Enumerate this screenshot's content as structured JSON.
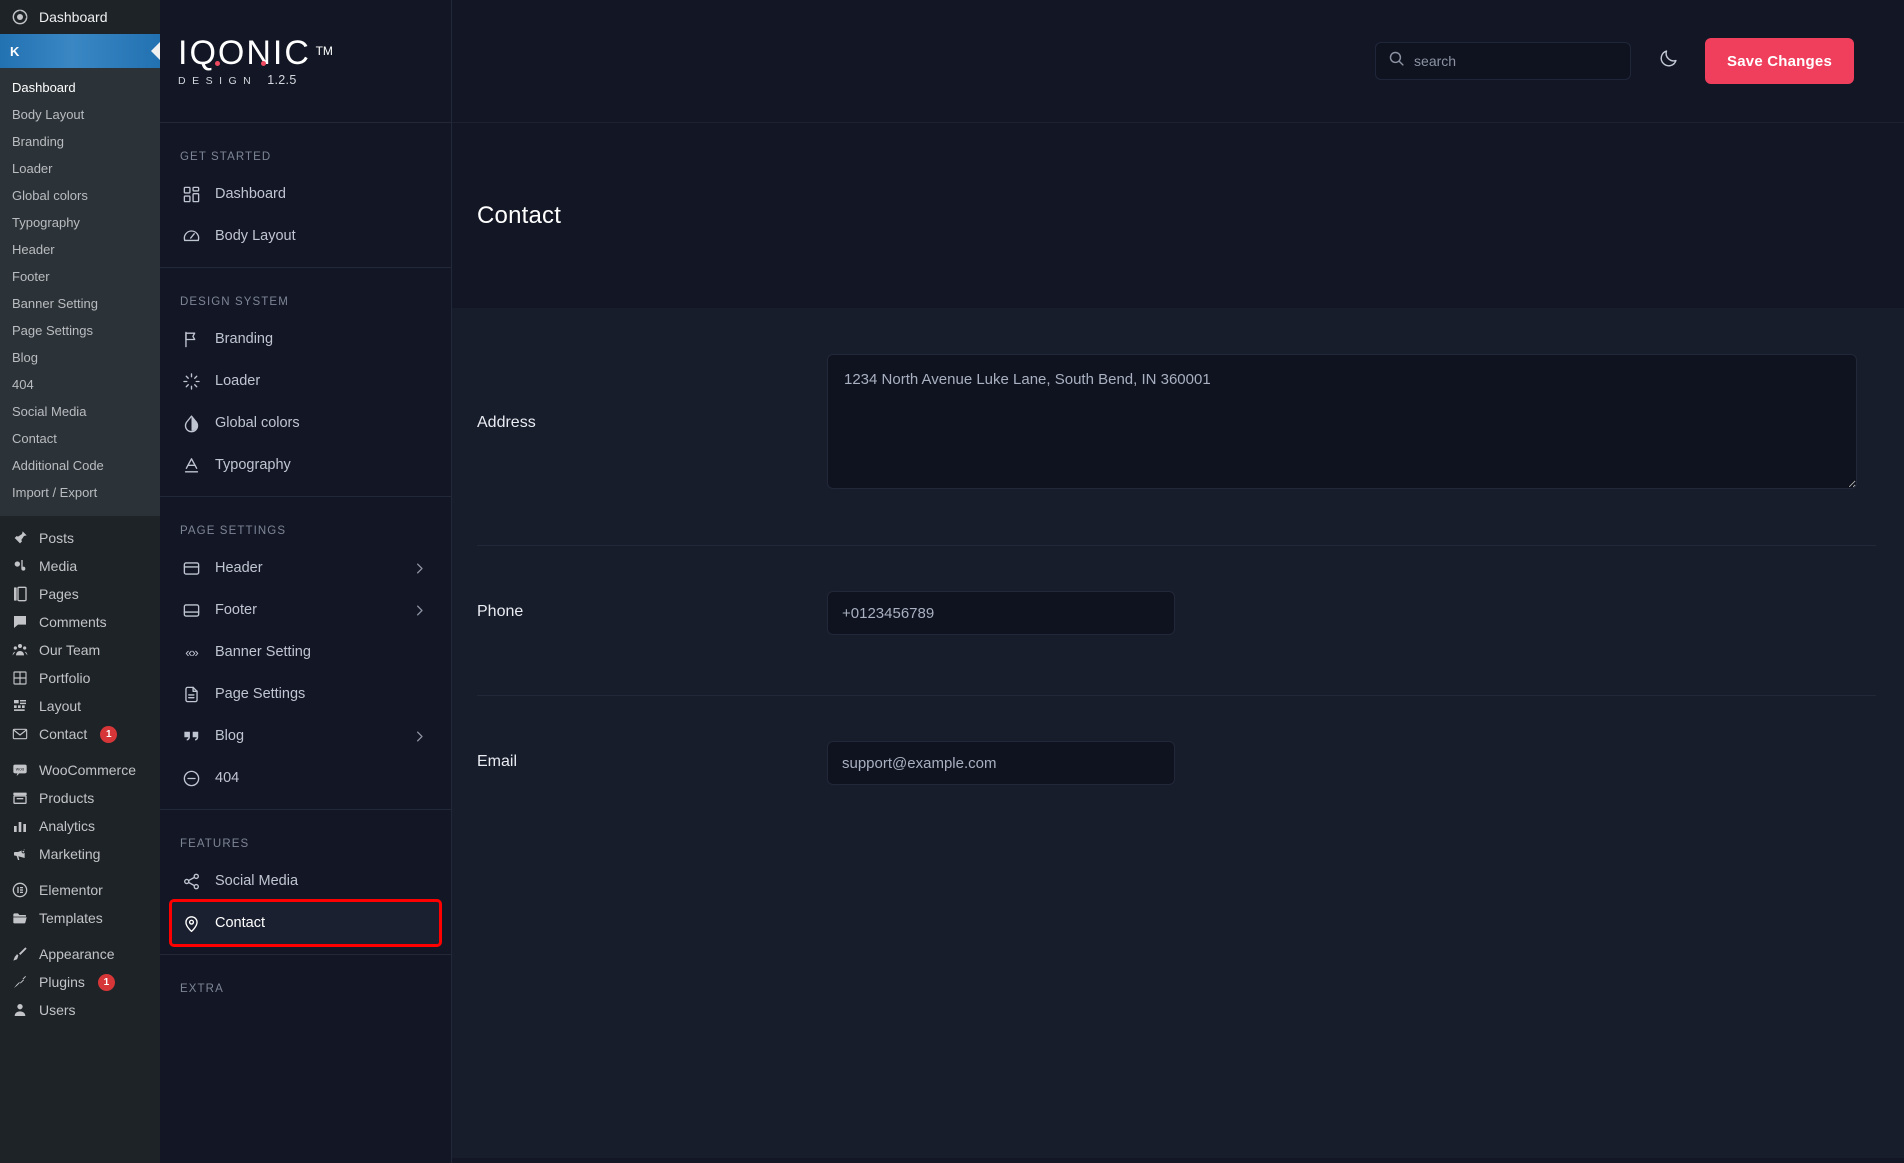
{
  "wp_admin": {
    "top_item": {
      "label": "Dashboard",
      "icon": "dashboard-gauge-icon"
    },
    "active_item": {
      "label": "K",
      "icon": "kit-logo-icon"
    },
    "submenu": [
      {
        "label": "Dashboard",
        "current": true
      },
      {
        "label": "Body Layout",
        "current": false
      },
      {
        "label": "Branding",
        "current": false
      },
      {
        "label": "Loader",
        "current": false
      },
      {
        "label": "Global colors",
        "current": false
      },
      {
        "label": "Typography",
        "current": false
      },
      {
        "label": "Header",
        "current": false
      },
      {
        "label": "Footer",
        "current": false
      },
      {
        "label": "Banner Setting",
        "current": false
      },
      {
        "label": "Page Settings",
        "current": false
      },
      {
        "label": "Blog",
        "current": false
      },
      {
        "label": "404",
        "current": false
      },
      {
        "label": "Social Media",
        "current": false
      },
      {
        "label": "Contact",
        "current": false
      },
      {
        "label": "Additional Code",
        "current": false
      },
      {
        "label": "Import / Export",
        "current": false
      }
    ],
    "groups": [
      {
        "items": [
          {
            "label": "Posts",
            "icon": "pin-icon",
            "badge": ""
          },
          {
            "label": "Media",
            "icon": "media-icon",
            "badge": ""
          },
          {
            "label": "Pages",
            "icon": "pages-icon",
            "badge": ""
          },
          {
            "label": "Comments",
            "icon": "comment-icon",
            "badge": ""
          },
          {
            "label": "Our Team",
            "icon": "team-icon",
            "badge": ""
          },
          {
            "label": "Portfolio",
            "icon": "grid-icon",
            "badge": ""
          },
          {
            "label": "Layout",
            "icon": "layout-icon",
            "badge": ""
          },
          {
            "label": "Contact",
            "icon": "envelope-icon",
            "badge": "1"
          }
        ]
      },
      {
        "items": [
          {
            "label": "WooCommerce",
            "icon": "woocommerce-icon",
            "badge": ""
          },
          {
            "label": "Products",
            "icon": "products-icon",
            "badge": ""
          },
          {
            "label": "Analytics",
            "icon": "analytics-bars-icon",
            "badge": ""
          },
          {
            "label": "Marketing",
            "icon": "megaphone-icon",
            "badge": ""
          }
        ]
      },
      {
        "items": [
          {
            "label": "Elementor",
            "icon": "elementor-icon",
            "badge": ""
          },
          {
            "label": "Templates",
            "icon": "folder-icon",
            "badge": ""
          }
        ]
      },
      {
        "items": [
          {
            "label": "Appearance",
            "icon": "brush-icon",
            "badge": ""
          },
          {
            "label": "Plugins",
            "icon": "plug-icon",
            "badge": "1"
          },
          {
            "label": "Users",
            "icon": "user-icon",
            "badge": ""
          }
        ]
      }
    ]
  },
  "brand": {
    "name": "IQONIC",
    "trademark": "TM",
    "tagline": "DESIGN",
    "version": "1.2.5"
  },
  "panel_nav": {
    "sections": [
      {
        "title": "GET STARTED",
        "items": [
          {
            "label": "Dashboard",
            "icon": "dashboard-grid-icon",
            "chevron": false,
            "highlight": false
          },
          {
            "label": "Body Layout",
            "icon": "speedometer-icon",
            "chevron": false,
            "highlight": false
          }
        ]
      },
      {
        "title": "DESIGN SYSTEM",
        "items": [
          {
            "label": "Branding",
            "icon": "flag-icon",
            "chevron": false,
            "highlight": false
          },
          {
            "label": "Loader",
            "icon": "spinner-icon",
            "chevron": false,
            "highlight": false
          },
          {
            "label": "Global colors",
            "icon": "droplet-icon",
            "chevron": false,
            "highlight": false
          },
          {
            "label": "Typography",
            "icon": "typography-a-icon",
            "chevron": false,
            "highlight": false
          }
        ]
      },
      {
        "title": "PAGE SETTINGS",
        "items": [
          {
            "label": "Header",
            "icon": "header-box-icon",
            "chevron": true,
            "highlight": false
          },
          {
            "label": "Footer",
            "icon": "footer-box-icon",
            "chevron": true,
            "highlight": false
          },
          {
            "label": "Banner Setting",
            "icon": "chevrons-icon",
            "chevron": false,
            "highlight": false
          },
          {
            "label": "Page Settings",
            "icon": "document-icon",
            "chevron": false,
            "highlight": false
          },
          {
            "label": "Blog",
            "icon": "quote-icon",
            "chevron": true,
            "highlight": false
          },
          {
            "label": "404",
            "icon": "minus-circle-icon",
            "chevron": false,
            "highlight": false
          }
        ]
      },
      {
        "title": "FEATURES",
        "items": [
          {
            "label": "Social Media",
            "icon": "share-icon",
            "chevron": false,
            "highlight": false
          },
          {
            "label": "Contact",
            "icon": "map-pin-icon",
            "chevron": false,
            "highlight": true
          }
        ]
      },
      {
        "title": "EXTRA",
        "items": []
      }
    ]
  },
  "topbar": {
    "search_placeholder": "search",
    "search_value": "",
    "dark_mode_icon": "moon-icon",
    "save_label": "Save Changes"
  },
  "page": {
    "title": "Contact"
  },
  "form": {
    "address": {
      "label": "Address",
      "value": "1234 North Avenue Luke Lane, South Bend, IN 360001",
      "placeholder": "Address"
    },
    "phone": {
      "label": "Phone",
      "value": "+0123456789",
      "placeholder": "Phone"
    },
    "email": {
      "label": "Email",
      "value": "support@example.com",
      "placeholder": "Email"
    }
  },
  "colors": {
    "accent": "#ef3f5c",
    "wp_active": "#2271b1",
    "badge": "#d63638",
    "panel_bg": "#131725",
    "card_bg": "#181d2b",
    "highlight_outline": "#ff0000"
  }
}
